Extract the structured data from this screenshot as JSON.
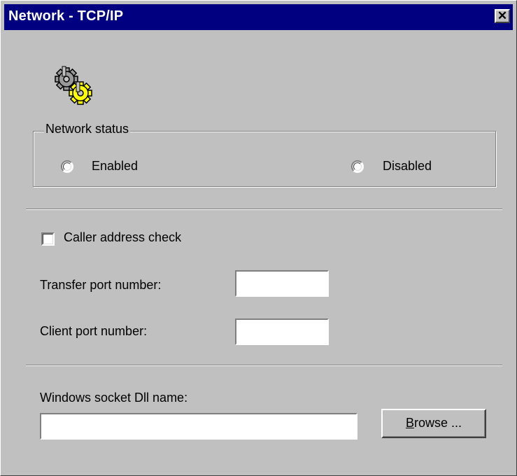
{
  "window": {
    "title": "Network - TCP/IP",
    "close_label": "✕"
  },
  "icon": "network-gears-icon",
  "network_status": {
    "legend": "Network status",
    "options": [
      {
        "label": "Enabled",
        "selected": false
      },
      {
        "label": "Disabled",
        "selected": false
      }
    ]
  },
  "caller_check": {
    "label": "Caller address check",
    "checked": false
  },
  "transfer_port": {
    "label": "Transfer port number:",
    "value": ""
  },
  "client_port": {
    "label": "Client port number:",
    "value": ""
  },
  "winsock": {
    "label": "Windows socket Dll name:",
    "value": ""
  },
  "browse_button": {
    "accel": "B",
    "rest": "rowse ..."
  },
  "colors": {
    "titlebar": "#000080",
    "face": "#c0c0c0",
    "gear_yellow": "#ffff00"
  }
}
